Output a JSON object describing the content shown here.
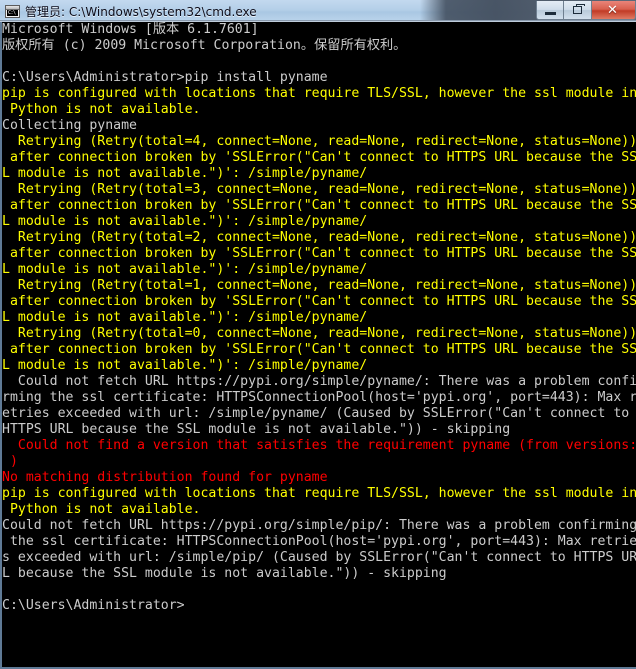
{
  "window": {
    "title": "管理员: C:\\Windows\\system32\\cmd.exe",
    "icon_text": "C:\\",
    "buttons": {
      "minimize": "minimize",
      "maximize": "restore",
      "close": "✕"
    }
  },
  "console": {
    "prompt_cwd": "C:\\Users\\Administrator>",
    "command": "pip install pyname",
    "colors": {
      "background": "#000000",
      "normal_text": "#cccccc",
      "warning_text": "#ffff00",
      "error_text": "#ff0000"
    },
    "lines": [
      {
        "t": "Microsoft Windows [版本 6.1.7601]",
        "c": "white"
      },
      {
        "t": "版权所有 (c) 2009 Microsoft Corporation。保留所有权利。",
        "c": "white"
      },
      {
        "t": "",
        "c": "white"
      },
      {
        "t": "C:\\Users\\Administrator>pip install pyname",
        "c": "white"
      },
      {
        "t": "pip is configured with locations that require TLS/SSL, however the ssl module in",
        "c": "yellow"
      },
      {
        "t": " Python is not available.",
        "c": "yellow"
      },
      {
        "t": "Collecting pyname",
        "c": "white"
      },
      {
        "t": "  Retrying (Retry(total=4, connect=None, read=None, redirect=None, status=None))",
        "c": "yellow"
      },
      {
        "t": " after connection broken by 'SSLError(\"Can't connect to HTTPS URL because the SS",
        "c": "yellow"
      },
      {
        "t": "L module is not available.\")': /simple/pyname/",
        "c": "yellow"
      },
      {
        "t": "  Retrying (Retry(total=3, connect=None, read=None, redirect=None, status=None))",
        "c": "yellow"
      },
      {
        "t": " after connection broken by 'SSLError(\"Can't connect to HTTPS URL because the SS",
        "c": "yellow"
      },
      {
        "t": "L module is not available.\")': /simple/pyname/",
        "c": "yellow"
      },
      {
        "t": "  Retrying (Retry(total=2, connect=None, read=None, redirect=None, status=None))",
        "c": "yellow"
      },
      {
        "t": " after connection broken by 'SSLError(\"Can't connect to HTTPS URL because the SS",
        "c": "yellow"
      },
      {
        "t": "L module is not available.\")': /simple/pyname/",
        "c": "yellow"
      },
      {
        "t": "  Retrying (Retry(total=1, connect=None, read=None, redirect=None, status=None))",
        "c": "yellow"
      },
      {
        "t": " after connection broken by 'SSLError(\"Can't connect to HTTPS URL because the SS",
        "c": "yellow"
      },
      {
        "t": "L module is not available.\")': /simple/pyname/",
        "c": "yellow"
      },
      {
        "t": "  Retrying (Retry(total=0, connect=None, read=None, redirect=None, status=None))",
        "c": "yellow"
      },
      {
        "t": " after connection broken by 'SSLError(\"Can't connect to HTTPS URL because the SS",
        "c": "yellow"
      },
      {
        "t": "L module is not available.\")': /simple/pyname/",
        "c": "yellow"
      },
      {
        "t": "  Could not fetch URL https://pypi.org/simple/pyname/: There was a problem confi",
        "c": "white"
      },
      {
        "t": "rming the ssl certificate: HTTPSConnectionPool(host='pypi.org', port=443): Max r",
        "c": "white"
      },
      {
        "t": "etries exceeded with url: /simple/pyname/ (Caused by SSLError(\"Can't connect to ",
        "c": "white"
      },
      {
        "t": "HTTPS URL because the SSL module is not available.\")) - skipping",
        "c": "white"
      },
      {
        "t": "  Could not find a version that satisfies the requirement pyname (from versions:",
        "c": "red"
      },
      {
        "t": " )",
        "c": "red"
      },
      {
        "t": "No matching distribution found for pyname",
        "c": "red"
      },
      {
        "t": "pip is configured with locations that require TLS/SSL, however the ssl module in",
        "c": "yellow"
      },
      {
        "t": " Python is not available.",
        "c": "yellow"
      },
      {
        "t": "Could not fetch URL https://pypi.org/simple/pip/: There was a problem confirming",
        "c": "white"
      },
      {
        "t": " the ssl certificate: HTTPSConnectionPool(host='pypi.org', port=443): Max retrie",
        "c": "white"
      },
      {
        "t": "s exceeded with url: /simple/pip/ (Caused by SSLError(\"Can't connect to HTTPS UR",
        "c": "white"
      },
      {
        "t": "L because the SSL module is not available.\")) - skipping",
        "c": "white"
      },
      {
        "t": "",
        "c": "white"
      },
      {
        "t": "C:\\Users\\Administrator>",
        "c": "white"
      }
    ]
  }
}
